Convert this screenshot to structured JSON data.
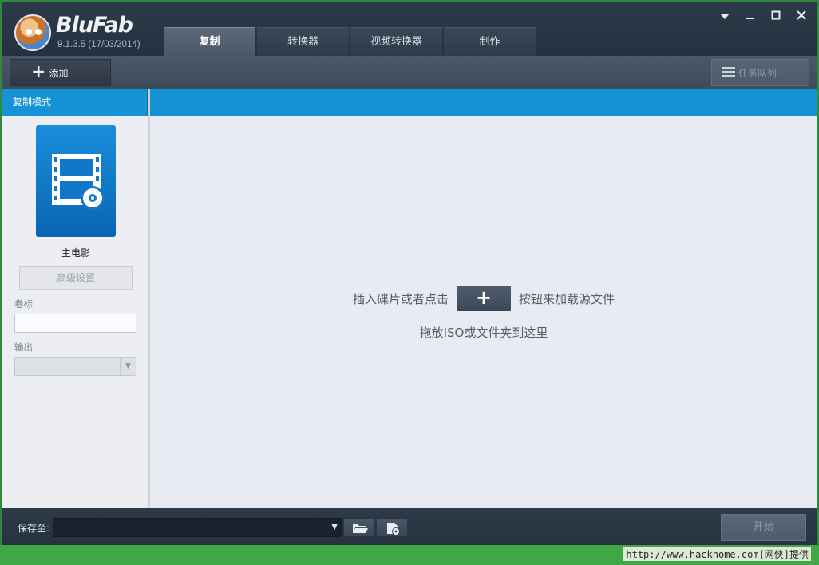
{
  "app": {
    "name": "BluFab",
    "version": "9.1.3.5 (17/03/2014)"
  },
  "tabs": [
    {
      "label": "复制",
      "active": true
    },
    {
      "label": "转换器",
      "active": false
    },
    {
      "label": "视频转换器",
      "active": false
    },
    {
      "label": "制作",
      "active": false
    }
  ],
  "window_controls": {
    "menu_icon": "chevron-down-icon",
    "minimize_icon": "minimize-icon",
    "maximize_icon": "maximize-icon",
    "close_icon": "close-icon"
  },
  "toolbar": {
    "add_label": "添加",
    "queue_label": "任务队列"
  },
  "sidebar": {
    "header": "复制模式",
    "mode_label": "主电影",
    "advanced_button": "高级设置",
    "volume_label": "卷标",
    "volume_value": "",
    "output_label": "输出",
    "output_value": ""
  },
  "main": {
    "hint_before": "插入碟片或者点击",
    "hint_after": "按钮来加载源文件",
    "hint_drag": "拖放ISO或文件夹到这里"
  },
  "bottom": {
    "save_label": "保存至:",
    "save_path": "",
    "start_button": "开始"
  },
  "footer": {
    "credit": "http://www.hackhome.com[网侠]提供"
  },
  "colors": {
    "accent_blue": "#1593d6",
    "footer_green": "#3fa845",
    "dark_chrome": "#26313d"
  }
}
